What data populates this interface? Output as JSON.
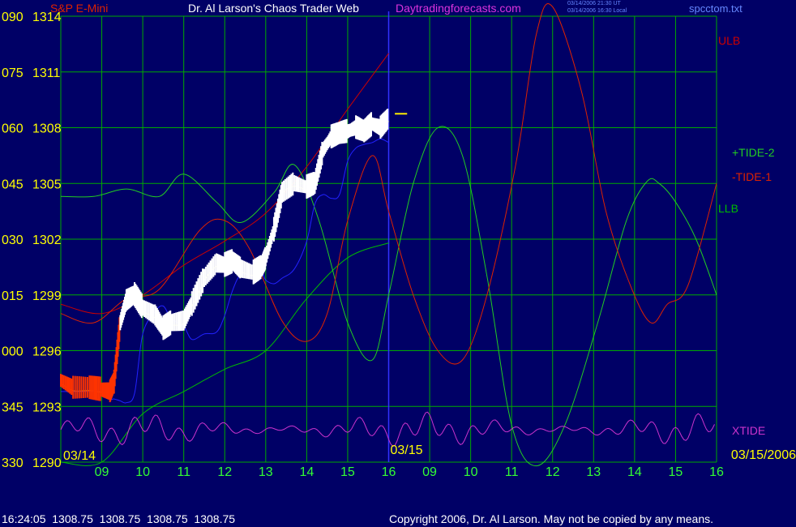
{
  "header": {
    "title_left": "S&P E-Mini",
    "title_center": "Dr. Al Larson's Chaos Trader Web",
    "site": "Daytradingforecasts.com",
    "times_line1": "03/14/2006 21:30 UT",
    "times_line2": "03/14/2006 16:30 Local",
    "file": "spcctom.txt"
  },
  "footer": {
    "quote": "16:24:05  1308.75  1308.75  1308.75  1308.75",
    "copyright": "Copyright 2006, Dr. Al Larson. May not be copied by any means."
  },
  "colors": {
    "background": "#000066",
    "grid": "#00aa00",
    "price_bars": "#ffffff",
    "ulb": "#cc0000",
    "llb": "#00bb00",
    "tide1": "#dd2200",
    "tide2": "#22cc22",
    "xtide": "#cc33cc",
    "ma_yellow": "#ffee00",
    "ma_blue": "#2222ff",
    "session_divider": "#3333ff"
  },
  "chart_data": {
    "type": "line",
    "title": "S&P E-Mini",
    "y_price_labels": [
      "1314",
      "1311",
      "1308",
      "1305",
      "1302",
      "1299",
      "1296",
      "1293",
      "1290"
    ],
    "y_angle_labels": [
      "090",
      "075",
      "060",
      "045",
      "030",
      "015",
      "000",
      "345",
      "330"
    ],
    "ylim": [
      1290,
      1314
    ],
    "x_tick_labels": [
      "09",
      "10",
      "11",
      "12",
      "13",
      "14",
      "15",
      "16",
      "09",
      "10",
      "11",
      "12",
      "13",
      "14",
      "15",
      "16"
    ],
    "x_range_hours": [
      8.0,
      24.0
    ],
    "date_labels": [
      "03/14",
      "03/15",
      "03/15/2006"
    ],
    "grid": true,
    "legend": [
      {
        "name": "ULB",
        "color": "#cc0000"
      },
      {
        "name": "+TIDE-2",
        "color": "#22cc22"
      },
      {
        "name": "-TIDE-1",
        "color": "#dd2200"
      },
      {
        "name": "LLB",
        "color": "#00bb00"
      },
      {
        "name": "XTIDE",
        "color": "#cc33cc"
      }
    ],
    "price": {
      "name": "S&P E-Mini",
      "x": [
        8.0,
        8.3,
        8.7,
        9.0,
        9.2,
        9.3,
        9.45,
        9.6,
        9.8,
        10.0,
        10.3,
        10.5,
        10.7,
        11.0,
        11.2,
        11.5,
        11.8,
        12.0,
        12.2,
        12.4,
        12.7,
        12.9,
        13.0,
        13.2,
        13.4,
        13.7,
        14.0,
        14.2,
        14.4,
        14.6,
        14.8,
        15.0,
        15.2,
        15.4,
        15.6,
        15.8,
        16.0
      ],
      "close": [
        1294.4,
        1294.0,
        1294.0,
        1293.9,
        1293.8,
        1294.3,
        1297.5,
        1298.7,
        1299.0,
        1298.3,
        1297.9,
        1297.2,
        1297.5,
        1297.6,
        1298.5,
        1299.9,
        1300.7,
        1300.6,
        1300.8,
        1300.4,
        1300.2,
        1300.5,
        1301.0,
        1302.5,
        1304.5,
        1305.0,
        1304.8,
        1305.0,
        1306.8,
        1307.5,
        1307.7,
        1307.8,
        1308.0,
        1307.8,
        1308.2,
        1308.0,
        1308.5
      ]
    },
    "series": [
      {
        "name": "ULB",
        "x": [
          8.0,
          9.0,
          10.0,
          11.0,
          12.0,
          13.0,
          14.0,
          15.0,
          16.0
        ],
        "values": [
          1298.5,
          1298.0,
          1299.0,
          1300.6,
          1301.9,
          1303.4,
          1305.9,
          1309.0,
          1312.0
        ]
      },
      {
        "name": "LLB",
        "x": [
          8.0,
          9.0,
          10.0,
          11.0,
          12.0,
          13.0,
          14.0,
          15.0,
          16.0
        ],
        "values": [
          1290.0,
          1290.0,
          1292.6,
          1293.8,
          1295.0,
          1296.0,
          1298.8,
          1301.0,
          1301.8
        ]
      },
      {
        "name": "+TIDE-2",
        "x": [
          8.0,
          8.8,
          9.6,
          10.4,
          11.0,
          11.8,
          12.4,
          13.2,
          13.7,
          14.3,
          15.0,
          15.6,
          16.0,
          16.6,
          17.2,
          17.8,
          18.4,
          19.0,
          19.6,
          20.3,
          21.1,
          21.8,
          22.3,
          22.6,
          23.0,
          23.5,
          24.0
        ],
        "values": [
          1304.3,
          1304.3,
          1304.7,
          1304.3,
          1305.5,
          1304.0,
          1302.9,
          1304.5,
          1306.0,
          1303.0,
          1297.5,
          1295.5,
          1299.0,
          1305.0,
          1308.0,
          1306.5,
          1300.0,
          1292.0,
          1289.8,
          1292.0,
          1297.5,
          1303.0,
          1305.1,
          1305.0,
          1304.0,
          1302.0,
          1299.0
        ]
      },
      {
        "name": "-TIDE-1",
        "x": [
          8.0,
          8.8,
          9.6,
          10.4,
          11.4,
          12.0,
          12.6,
          13.4,
          14.0,
          14.5,
          15.0,
          15.6,
          16.0,
          16.6,
          17.2,
          17.8,
          18.4,
          19.1,
          19.6,
          20.0,
          20.7,
          21.3,
          21.9,
          22.4,
          22.8,
          23.3,
          24.0
        ],
        "values": [
          1298.0,
          1297.5,
          1298.8,
          1299.3,
          1302.5,
          1303.0,
          1301.5,
          1297.6,
          1296.5,
          1298.0,
          1303.0,
          1306.5,
          1303.5,
          1299.0,
          1296.0,
          1295.5,
          1299.0,
          1306.0,
          1313.0,
          1314.5,
          1310.0,
          1303.5,
          1299.5,
          1297.5,
          1298.5,
          1299.5,
          1305.0
        ]
      },
      {
        "name": "XTIDE",
        "x_range": [
          8.0,
          24.0
        ],
        "note_values_scale": "0-1 relative amplitude in lower band"
      }
    ]
  }
}
